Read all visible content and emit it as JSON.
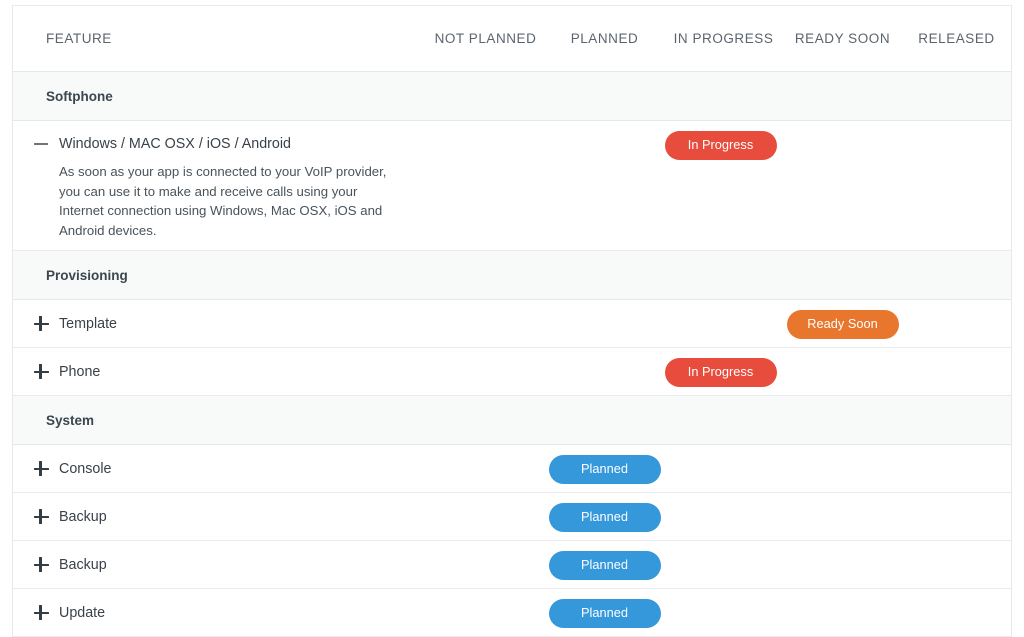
{
  "table": {
    "columns": [
      {
        "key": "feature",
        "label": "FEATURE"
      },
      {
        "key": "not_planned",
        "label": "NOT PLANNED"
      },
      {
        "key": "planned",
        "label": "PLANNED"
      },
      {
        "key": "in_progress",
        "label": "IN PROGRESS"
      },
      {
        "key": "ready_soon",
        "label": "READY SOON"
      },
      {
        "key": "released",
        "label": "RELEASED"
      }
    ],
    "groups": [
      {
        "title": "Softphone",
        "rows": [
          {
            "name": "Windows / MAC OSX / iOS / Android",
            "toggle": "minus-icon",
            "expanded": true,
            "description": "As soon as your app is connected to your VoIP provider, you can use it to make and receive calls using your Internet connection using Windows, Mac OSX, iOS and Android devices.",
            "status_column": "in_progress",
            "status_label": "In Progress"
          }
        ]
      },
      {
        "title": "Provisioning",
        "rows": [
          {
            "name": "Template",
            "toggle": "plus-icon",
            "expanded": false,
            "description": "",
            "status_column": "ready_soon",
            "status_label": "Ready Soon"
          },
          {
            "name": "Phone",
            "toggle": "plus-icon",
            "expanded": false,
            "description": "",
            "status_column": "in_progress",
            "status_label": "In Progress"
          }
        ]
      },
      {
        "title": "System",
        "rows": [
          {
            "name": "Console",
            "toggle": "plus-icon",
            "expanded": false,
            "description": "",
            "status_column": "planned",
            "status_label": "Planned"
          },
          {
            "name": "Backup",
            "toggle": "plus-icon",
            "expanded": false,
            "description": "",
            "status_column": "planned",
            "status_label": "Planned"
          },
          {
            "name": "Backup",
            "toggle": "plus-icon",
            "expanded": false,
            "description": "",
            "status_column": "planned",
            "status_label": "Planned"
          },
          {
            "name": "Update",
            "toggle": "plus-icon",
            "expanded": false,
            "description": "",
            "status_column": "planned",
            "status_label": "Planned"
          }
        ]
      }
    ]
  },
  "colors": {
    "planned": "#3498db",
    "in_progress": "#e74c3c",
    "ready_soon": "#e8762c",
    "released": "#27ae60",
    "not_planned": "#95a5a6",
    "group_header_bg": "#f8f9f9",
    "border": "#e6e8ea",
    "text": "#34404a"
  }
}
